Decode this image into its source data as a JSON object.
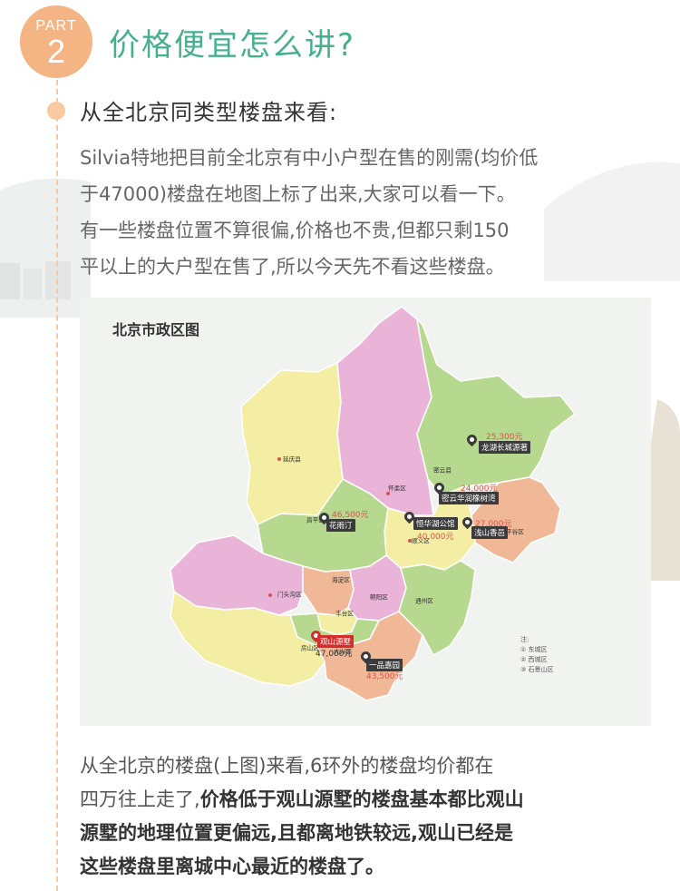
{
  "header": {
    "part_word": "PART",
    "part_number": "2",
    "title": "价格便宜怎么讲?"
  },
  "subheading": "从全北京同类型楼盘来看:",
  "intro_lines": [
    "Silvia特地把目前全北京有中小户型在售的刚需(均价低",
    "于47000)楼盘在地图上标了出来,大家可以看一下。",
    "有一些楼盘位置不算很偏,价格也不贵,但都只剩150",
    "平以上的大户型在售了,所以今天先不看这些楼盘。"
  ],
  "map": {
    "title": "北京市政区图",
    "districts": {
      "yanqing": "延庆县",
      "huairou": "怀柔区",
      "miyun": "密云县",
      "changping": "昌平区",
      "shunyi": "顺义区",
      "mentougou": "门头沟区",
      "haidian": "海淀区",
      "chaoyang": "朝阳区",
      "fengtai": "丰台区",
      "tongzhou": "通州区",
      "fangshan": "房山区",
      "daxing": "大兴区",
      "pinggu": "平谷区"
    },
    "note": {
      "label": "注:",
      "items": [
        "① 东城区",
        "② 西城区",
        "③ 石景山区"
      ]
    },
    "estates": [
      {
        "name": "龙湖长城源著",
        "price": "25,300元",
        "highlight": false
      },
      {
        "name": "密云华润橡树湾",
        "price": "24,000元",
        "highlight": false
      },
      {
        "name": "浅山香邑",
        "price": "27,000元",
        "highlight": false
      },
      {
        "name": "花雨汀",
        "price": "46,500元",
        "highlight": false
      },
      {
        "name": "恒华湖公馆",
        "price": "40,000元",
        "highlight": false
      },
      {
        "name": "观山源墅",
        "price": "47,000元",
        "highlight": true
      },
      {
        "name": "一品嘉园",
        "price": "43,500元",
        "highlight": false
      }
    ],
    "colors": {
      "pink": "#eab4d9",
      "green": "#b6d98f",
      "yellow": "#f3eea4",
      "salmon": "#f0b896",
      "red_pin": "#d62b2b"
    }
  },
  "conclusion": {
    "line1": "从全北京的楼盘(上图)来看,6环外的楼盘均价都在",
    "line2_normal": "四万往上走了,",
    "line2_bold": "价格低于观山源墅的楼盘基本都比观山",
    "line3": "源墅的地理位置更偏远,且都离地铁较远,观山已经是",
    "line4": "这些楼盘里离城中心最近的楼盘了。"
  }
}
